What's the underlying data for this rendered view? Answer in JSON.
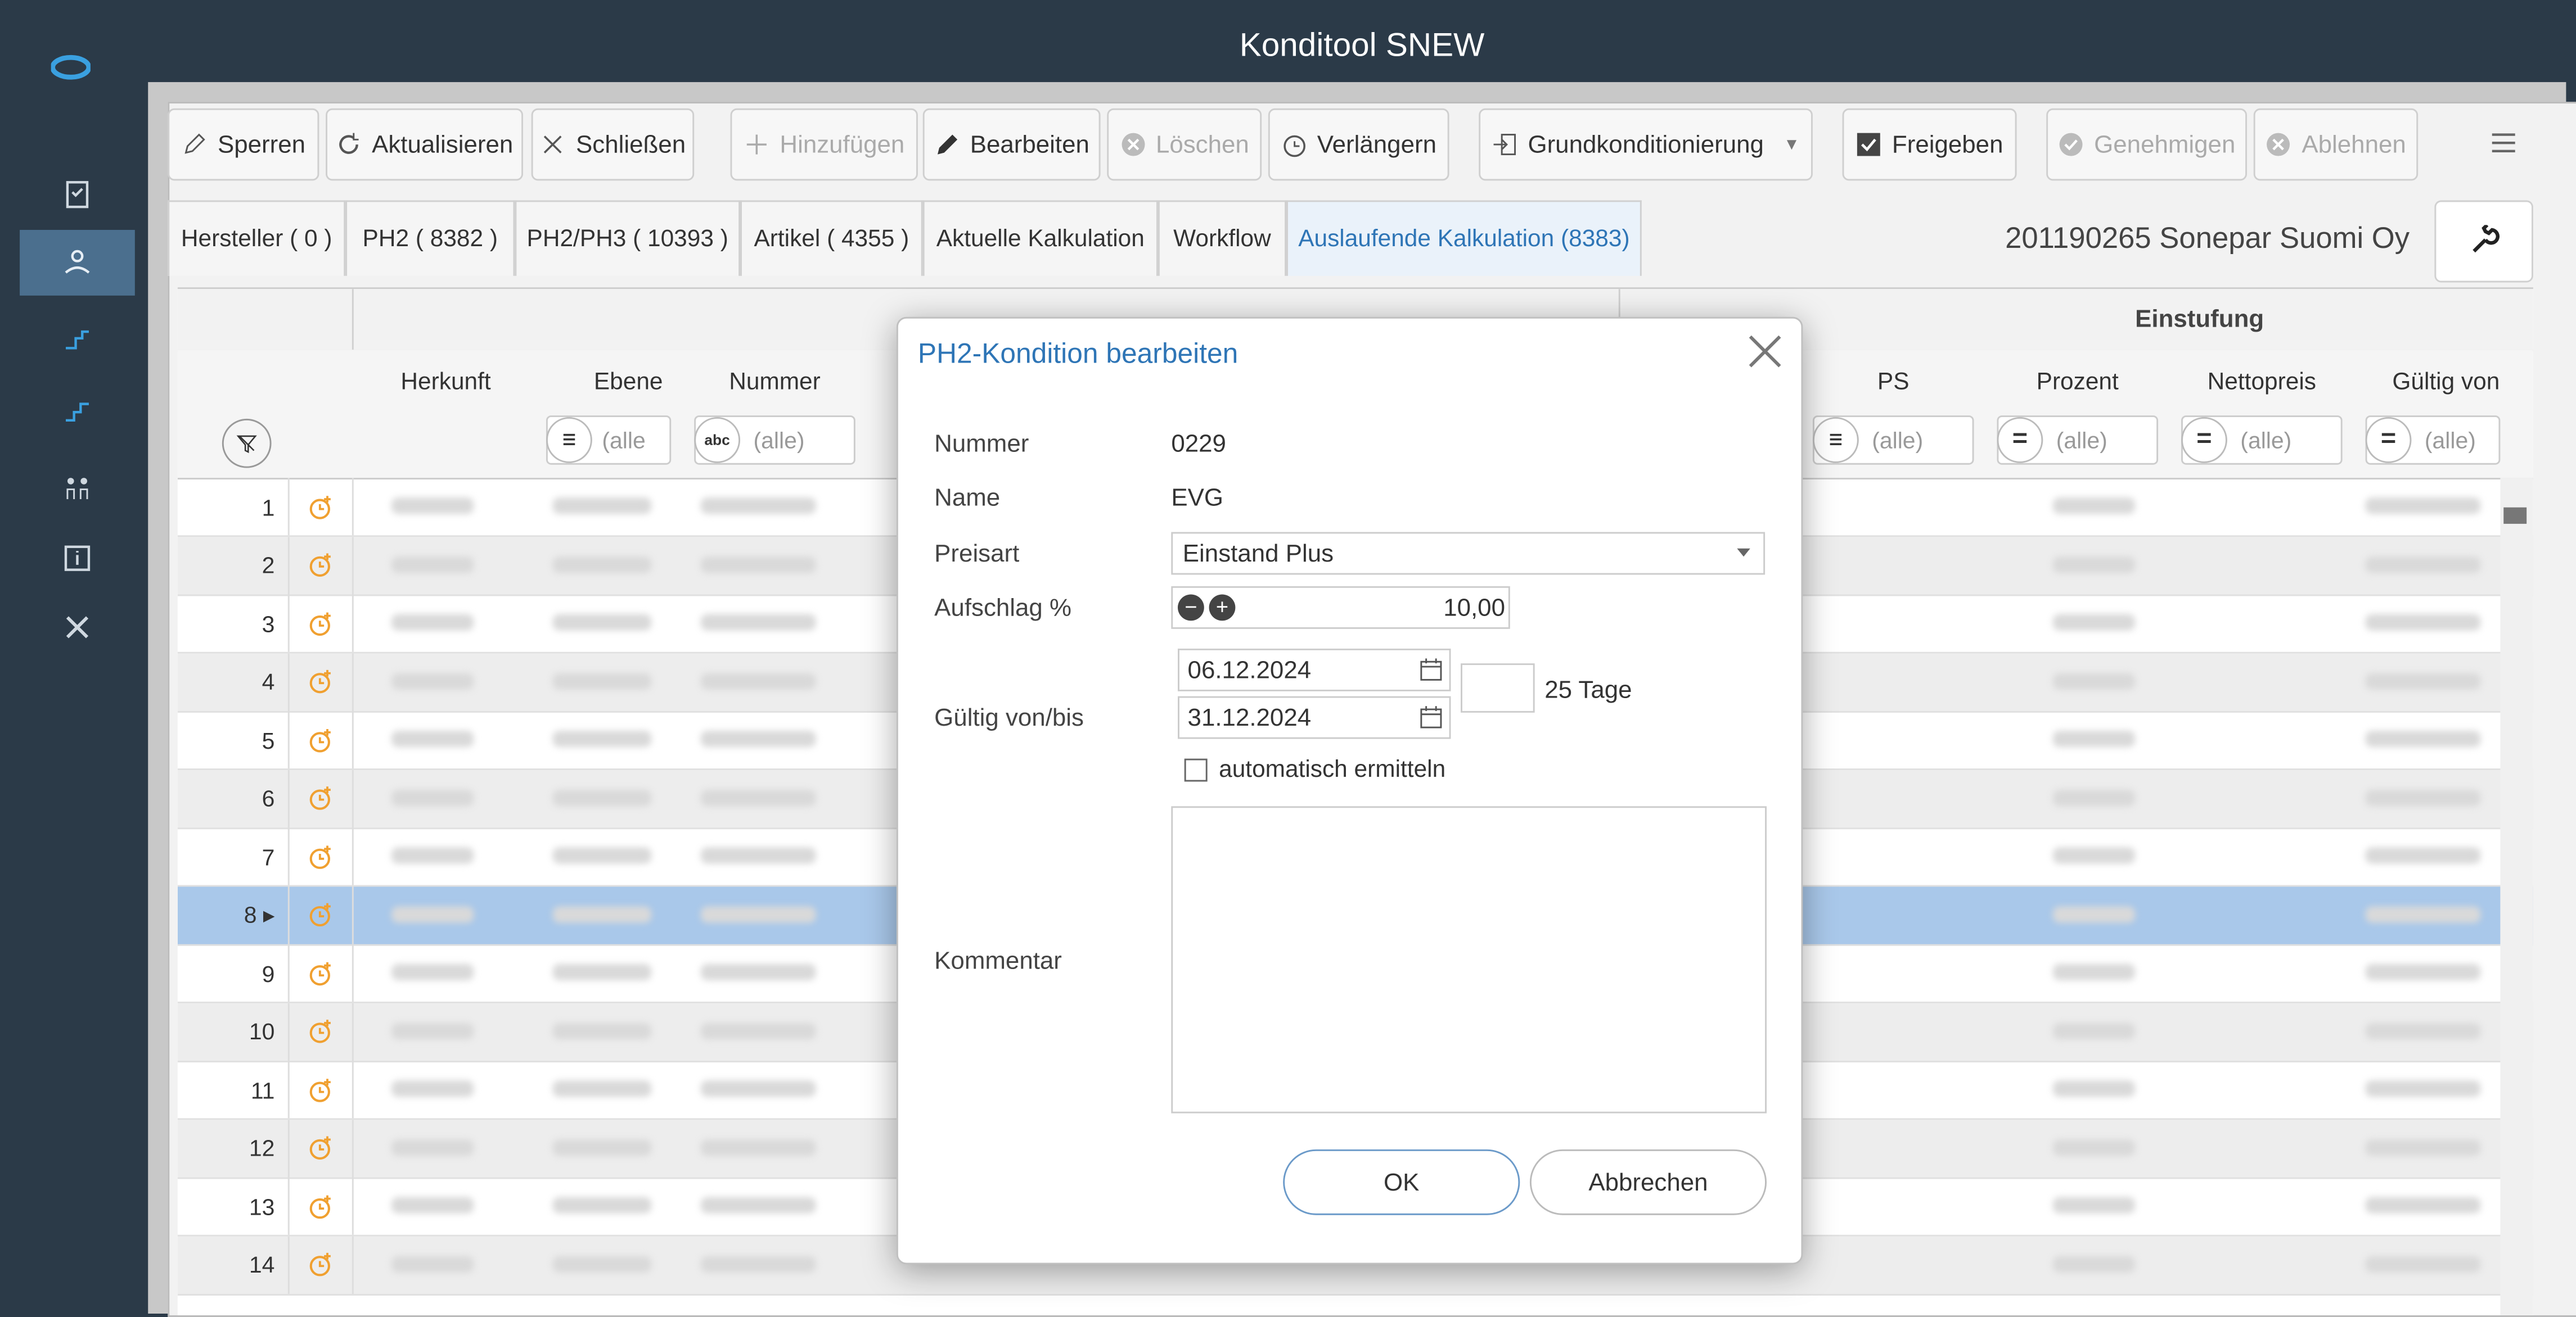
{
  "app": {
    "title": "Konditool SNEW"
  },
  "sidebar": {
    "icons": [
      "logo-icon",
      "clipboard-icon",
      "user-hand-icon",
      "price-chart-icon",
      "price-chart-2-icon",
      "people-icon",
      "info-icon",
      "tools-icon"
    ],
    "active_index": 2
  },
  "toolbar": {
    "sperren": "Sperren",
    "aktualisieren": "Aktualisieren",
    "schliessen": "Schließen",
    "hinzufuegen": "Hinzufügen",
    "bearbeiten": "Bearbeiten",
    "loeschen": "Löschen",
    "verlaengern": "Verlängern",
    "grundkonditionierung": "Grundkonditionierung",
    "freigeben": "Freigeben",
    "genehmigen": "Genehmigen",
    "ablehnen": "Ablehnen"
  },
  "tabs": [
    {
      "label": "Hersteller ( 0 )"
    },
    {
      "label": "PH2 ( 8382 )"
    },
    {
      "label": "PH2/PH3 ( 10393 )"
    },
    {
      "label": "Artikel ( 4355 )"
    },
    {
      "label": "Aktuelle Kalkulation"
    },
    {
      "label": "Workflow"
    },
    {
      "label": "Auslaufende Kalkulation (8383)"
    }
  ],
  "company": "201190265 Sonepar Suomi Oy",
  "grid": {
    "group_header_right": "Einstufung",
    "columns": {
      "herkunft": "Herkunft",
      "ebene": "Ebene",
      "nummer": "Nummer",
      "ps": "PS",
      "prozent": "Prozent",
      "nettopreis": "Nettopreis",
      "gueltig_von": "Gültig von"
    },
    "filter_placeholder": "(alle)",
    "filter_placeholder_short": "(alle",
    "abc_label": "abc",
    "row_numbers": [
      "1",
      "2",
      "3",
      "4",
      "5",
      "6",
      "7",
      "8",
      "9",
      "10",
      "11",
      "12",
      "13",
      "14"
    ],
    "selected_row": "8"
  },
  "dialog": {
    "title": "PH2-Kondition bearbeiten",
    "nummer_label": "Nummer",
    "nummer_value": "0229",
    "name_label": "Name",
    "name_value": "EVG",
    "preisart_label": "Preisart",
    "preisart_value": "Einstand Plus",
    "aufschlag_label": "Aufschlag %",
    "aufschlag_value": "10,00",
    "gueltig_label": "Gültig von/bis",
    "date_from": "06.12.2024",
    "date_to": "31.12.2024",
    "days": "25 Tage",
    "auto_label": "automatisch ermitteln",
    "auto_checked": false,
    "kommentar_label": "Kommentar",
    "kommentar_value": "",
    "ok": "OK",
    "cancel": "Abbrechen"
  },
  "colors": {
    "sidebar": "#2b3a48",
    "accent": "#2e75b6",
    "selected_row": "#a9c8ea",
    "clock": "#f0a030"
  }
}
